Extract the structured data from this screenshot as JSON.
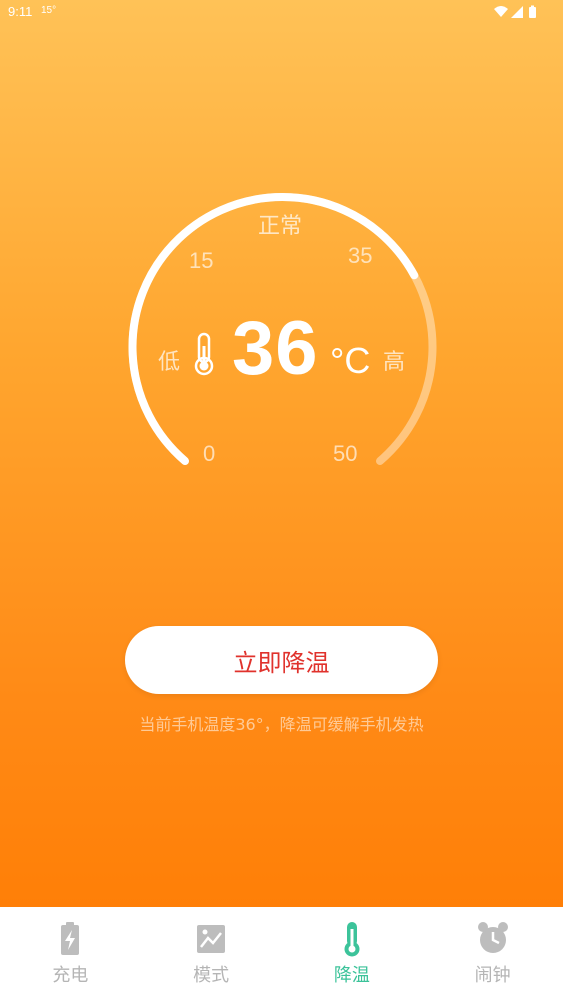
{
  "status_bar": {
    "time": "9:11",
    "extra": "15°"
  },
  "gauge": {
    "status_label": "正常",
    "tick_labels": [
      "0",
      "15",
      "35",
      "50"
    ],
    "low_label": "低",
    "high_label": "高",
    "temperature": "36",
    "unit": "°C",
    "level_fraction": 0.72
  },
  "action": {
    "button_label": "立即降温",
    "hint": "当前手机温度36°，降温可缓解手机发热"
  },
  "tabs": [
    {
      "label": "充电",
      "icon": "battery-charge-icon",
      "active": false
    },
    {
      "label": "模式",
      "icon": "image-mode-icon",
      "active": false
    },
    {
      "label": "降温",
      "icon": "thermometer-icon",
      "active": true
    },
    {
      "label": "闹钟",
      "icon": "alarm-clock-icon",
      "active": false
    }
  ],
  "colors": {
    "accent": "#3cc39a",
    "button_text": "#e0322c",
    "tab_inactive": "#b5b5b5"
  }
}
